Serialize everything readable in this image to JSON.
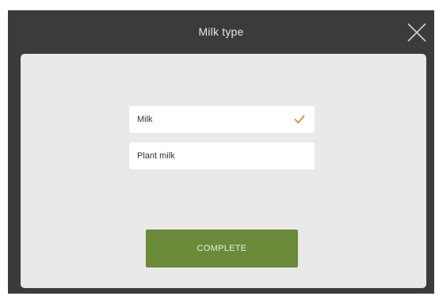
{
  "dialog": {
    "title": "Milk type",
    "close_icon": "close-icon"
  },
  "options": [
    {
      "label": "Milk",
      "selected": true
    },
    {
      "label": "Plant milk",
      "selected": false
    }
  ],
  "actions": {
    "complete_label": "COMPLETE"
  },
  "colors": {
    "frame": "#3b3b3b",
    "panel": "#e9e9e9",
    "accent_check": "#e08a3c",
    "button": "#6b8a3a"
  }
}
